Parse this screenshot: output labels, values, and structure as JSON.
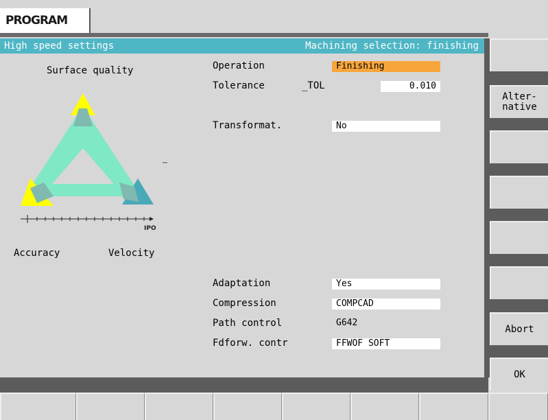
{
  "header": {
    "program_tab": "PROGRAM"
  },
  "titlebar": {
    "left": "High speed settings",
    "right": "Machining selection: finishing"
  },
  "diagram": {
    "top_label": "Surface quality",
    "bottom_left_label": "Accuracy",
    "bottom_right_label": "Velocity",
    "axis_label": "IPO"
  },
  "form": {
    "operation": {
      "label": "Operation",
      "value": "Finishing"
    },
    "tolerance": {
      "label": "Tolerance",
      "var": "_TOL",
      "value": "0.010"
    },
    "transformat": {
      "label": "Transformat.",
      "value": "No"
    },
    "adaptation": {
      "label": "Adaptation",
      "value": "Yes"
    },
    "compression": {
      "label": "Compression",
      "value": "COMPCAD"
    },
    "path_control": {
      "label": "Path control",
      "value": "G642"
    },
    "fdforw": {
      "label": "Fdforw. contr",
      "value": "FFWOF SOFT"
    }
  },
  "softkeys": {
    "k1": "",
    "k2": "Alter-\nnative",
    "k3": "",
    "k4": "",
    "k5": "",
    "k6": "",
    "k7": "Abort",
    "k8": "OK"
  },
  "colors": {
    "titlebar": "#4fb6c5",
    "highlight": "#f7a63c",
    "triangle": "#7fe8c4",
    "yellow": "#ffff00",
    "teal": "#4aa9b8"
  }
}
